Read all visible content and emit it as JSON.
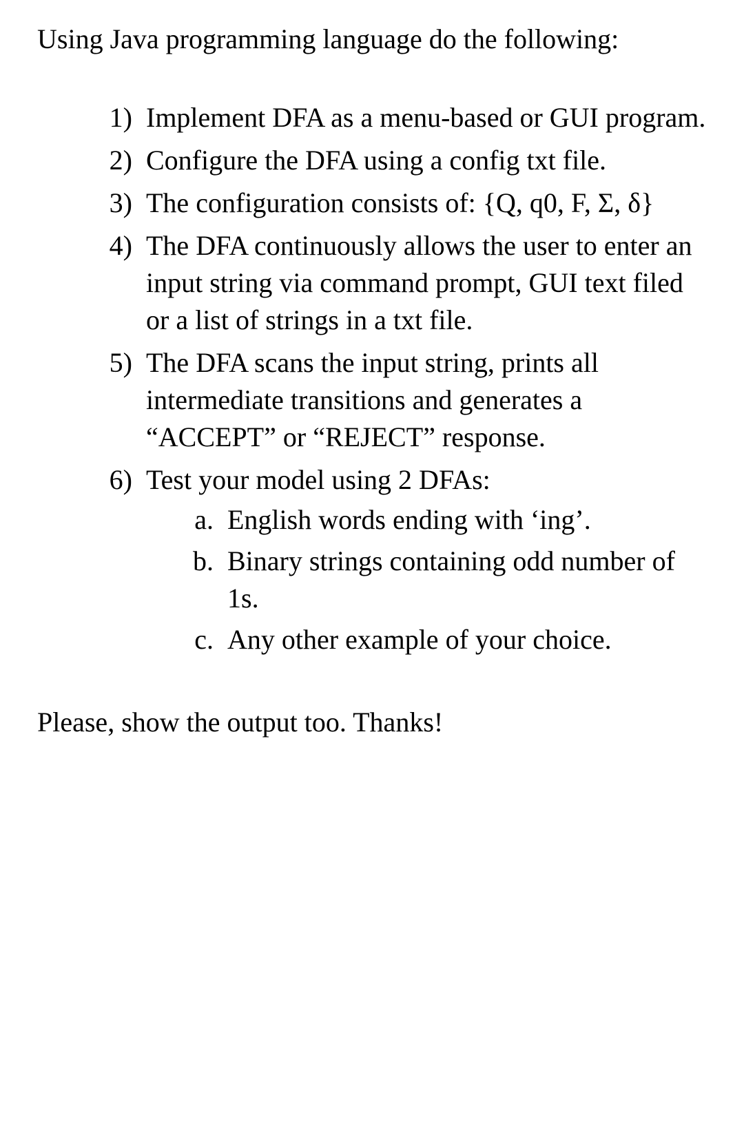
{
  "intro": "Using Java programming language do the following:",
  "items": [
    {
      "marker": "1)",
      "text": "Implement DFA as a menu-based or GUI program."
    },
    {
      "marker": "2)",
      "text": "Configure the DFA using a config txt file."
    },
    {
      "marker": "3)",
      "text": "The configuration consists of: {Q, q0, F, Σ, δ}"
    },
    {
      "marker": "4)",
      "text": "The DFA continuously allows the user to enter an input string via command prompt, GUI text filed or a list of strings in a txt file."
    },
    {
      "marker": "5)",
      "text": "The DFA scans the input string, prints all intermediate transitions and generates a “ACCEPT” or “REJECT” response."
    },
    {
      "marker": "6)",
      "text": "Test your model using 2 DFAs:",
      "subitems": [
        {
          "marker": "a.",
          "text": "English words ending with ‘ing’."
        },
        {
          "marker": "b.",
          "text": "Binary strings containing odd number of 1s."
        },
        {
          "marker": "c.",
          "text": "Any other example of your choice."
        }
      ]
    }
  ],
  "closing": "Please, show the output too. Thanks!"
}
